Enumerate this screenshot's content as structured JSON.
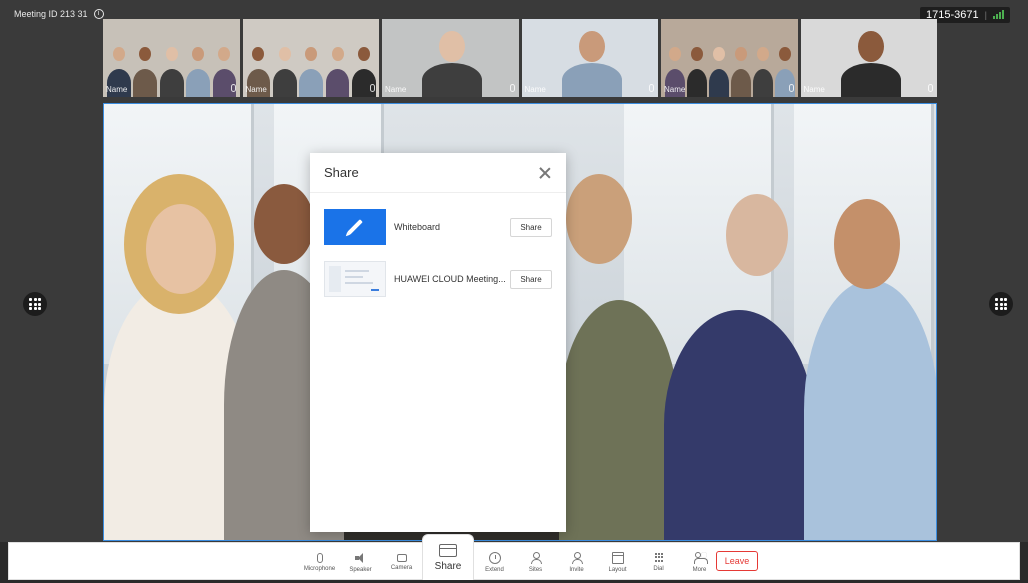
{
  "header": {
    "meeting_id": "Meeting ID 213 31",
    "meeting_number": "1715-3671",
    "separator": "|"
  },
  "thumbnails": [
    {
      "name": "Name",
      "bg": "#c7c1b8",
      "people": 5
    },
    {
      "name": "Name",
      "bg": "#cfcac3",
      "people": 5
    },
    {
      "name": "Name",
      "bg": "#c2c4c4",
      "people": 1
    },
    {
      "name": "Name",
      "bg": "#d7dde3",
      "people": 1
    },
    {
      "name": "Name",
      "bg": "#b8a99a",
      "people": 6
    },
    {
      "name": "Name",
      "bg": "#d9d9d9",
      "people": 1
    }
  ],
  "share_dialog": {
    "title": "Share",
    "items": [
      {
        "label": "Whiteboard",
        "button": "Share",
        "icon": "pencil-icon"
      },
      {
        "label": "HUAWEI CLOUD Meeting...",
        "button": "Share",
        "icon": "screen-thumbnail"
      }
    ]
  },
  "toolbar": {
    "items": [
      {
        "id": "microphone",
        "label": "Microphone",
        "icon": "mic"
      },
      {
        "id": "speaker",
        "label": "Speaker",
        "icon": "speaker"
      },
      {
        "id": "camera",
        "label": "Camera",
        "icon": "camera"
      },
      {
        "id": "share",
        "label": "Share",
        "icon": "share",
        "active": true
      },
      {
        "id": "extend",
        "label": "Extend",
        "icon": "clock"
      },
      {
        "id": "sites",
        "label": "Sites",
        "icon": "user"
      },
      {
        "id": "invite",
        "label": "Invite",
        "icon": "user"
      },
      {
        "id": "layout",
        "label": "Layout",
        "icon": "layout"
      },
      {
        "id": "dial",
        "label": "Dial",
        "icon": "dial"
      },
      {
        "id": "more",
        "label": "More",
        "icon": "more"
      }
    ],
    "leave_label": "Leave"
  },
  "colors": {
    "accent": "#1a73e8",
    "leave": "#e53935",
    "video_border": "#3b8de0"
  }
}
